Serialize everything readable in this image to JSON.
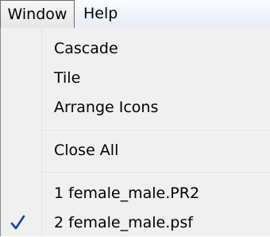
{
  "menubar": {
    "window_label": "Window",
    "help_label": "Help"
  },
  "window_menu": {
    "items": [
      {
        "label": "Cascade",
        "checked": false
      },
      {
        "label": "Tile",
        "checked": false
      },
      {
        "label": "Arrange Icons",
        "checked": false
      },
      {
        "label": "Close All",
        "checked": false
      },
      {
        "label": "1 female_male.PR2",
        "checked": false
      },
      {
        "label": "2 female_male.psf",
        "checked": true
      }
    ],
    "check_icon": "checkmark-icon",
    "check_color": "#1c3fa8"
  }
}
